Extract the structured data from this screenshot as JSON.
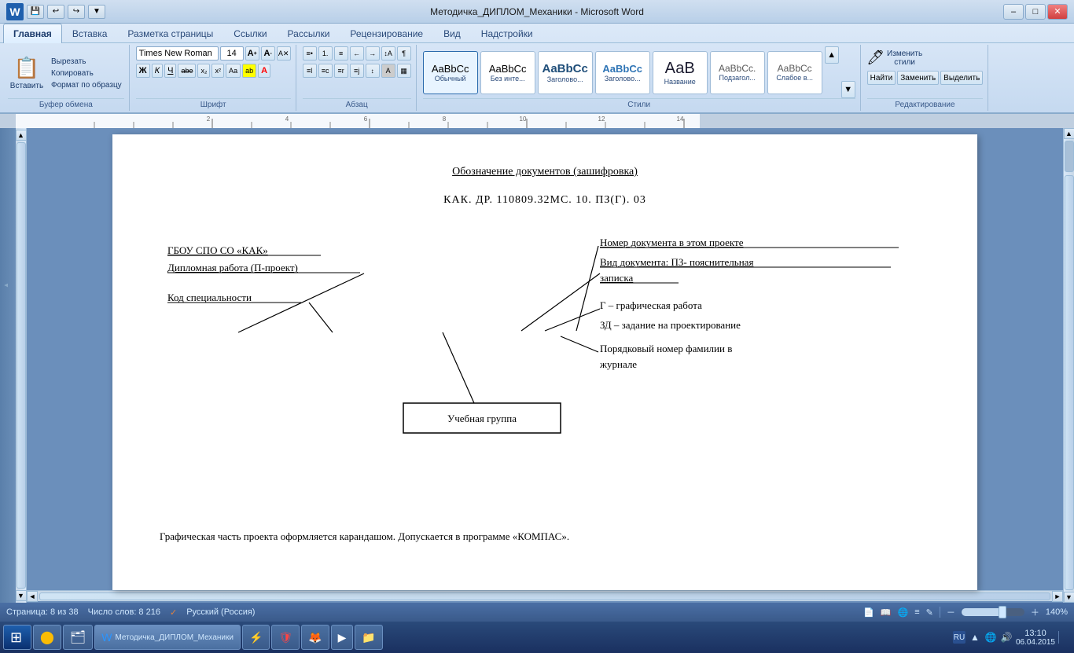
{
  "titlebar": {
    "title": "Методичка_ДИПЛОМ_Механики - Microsoft Word",
    "word_letter": "W",
    "min_label": "–",
    "max_label": "□",
    "close_label": "✕"
  },
  "ribbon": {
    "tabs": [
      "Главная",
      "Вставка",
      "Разметка страницы",
      "Ссылки",
      "Рассылки",
      "Рецензирование",
      "Вид",
      "Надстройки"
    ],
    "active_tab": "Главная",
    "clipboard": {
      "label": "Буфер обмена",
      "paste_label": "Вставить",
      "cut_label": "Вырезать",
      "copy_label": "Копировать",
      "format_label": "Формат по образцу"
    },
    "font": {
      "label": "Шрифт",
      "name": "Times New Roman",
      "size": "14",
      "grow_label": "A",
      "shrink_label": "A",
      "clear_label": "A",
      "bold_label": "Ж",
      "italic_label": "К",
      "underline_label": "Ч",
      "strike_label": "abe",
      "sub_label": "x₂",
      "sup_label": "x²",
      "case_label": "Аа",
      "highlight_label": "ab",
      "color_label": "А"
    },
    "paragraph": {
      "label": "Абзац"
    },
    "styles": {
      "label": "Стили",
      "items": [
        {
          "label": "Обычный",
          "sample": "AaBbCc"
        },
        {
          "label": "Без инте...",
          "sample": "AaBbCc"
        },
        {
          "label": "Заголово...",
          "sample": "AaBbCc"
        },
        {
          "label": "Заголово...",
          "sample": "AaBbCc"
        },
        {
          "label": "Название",
          "sample": "AaB"
        },
        {
          "label": "Подзагол...",
          "sample": "AaBbCc."
        },
        {
          "label": "Слабое в...",
          "sample": "AaBbCc"
        }
      ]
    },
    "editing": {
      "label": "Редактирование",
      "find_label": "Найти",
      "replace_label": "Заменить",
      "select_label": "Выделить",
      "change_styles_label": "Изменить стили"
    }
  },
  "document": {
    "title": "Обозначение документов (зашифровка)",
    "code_line": "КАК. ДР. 110809.32МС. 10. ПЗ(Г). 03",
    "labels": {
      "left1": "ГБОУ СПО СО «КАК»",
      "left2": "Дипломная работа (П-проект)",
      "left3": "Код специальности",
      "right1": "Номер документа в этом проекте",
      "right2": "Вид документа: ПЗ- пояснительная",
      "right2b": "записка",
      "right3": "Г – графическая работа",
      "right4": "ЗД – задание на проектирование",
      "right5": "Порядковый номер фамилии в",
      "right5b": "журнале",
      "box_label": "Учебная группа"
    },
    "footer_text": "Графическая часть проекта оформляется карандашом. Допускается в программе «КОМПАС»."
  },
  "statusbar": {
    "page_info": "Страница: 8 из 38",
    "words_info": "Число слов: 8 216",
    "language": "Русский (Россия)",
    "zoom": "140%"
  },
  "taskbar": {
    "start_label": "⊞",
    "time": "13:10",
    "date": "06.04.2015",
    "language_indicator": "RU",
    "word_task": "Методичка_ДИПЛОМ_Механики"
  }
}
